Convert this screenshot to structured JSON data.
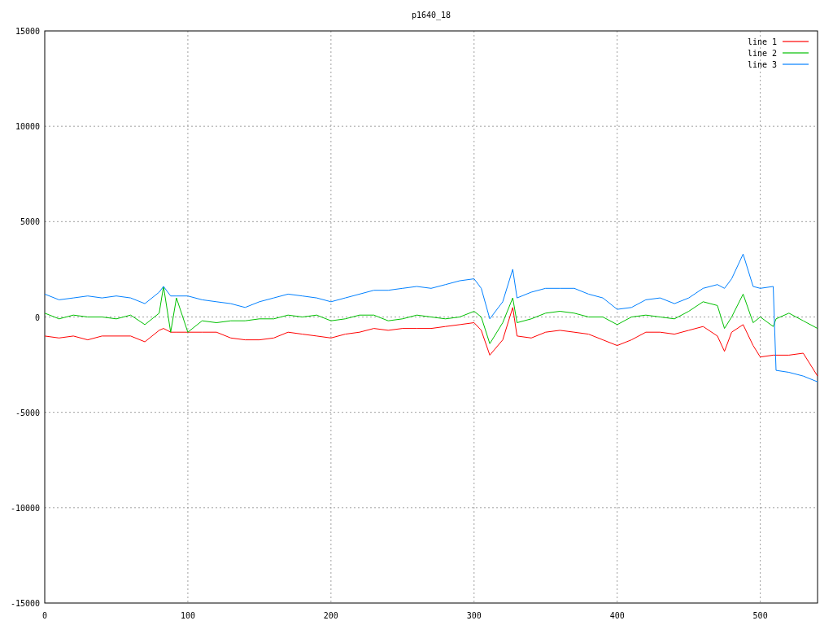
{
  "chart_data": {
    "type": "line",
    "title": "p1640_18",
    "x": [
      0,
      10,
      20,
      30,
      40,
      50,
      60,
      70,
      80,
      83,
      88,
      92,
      100,
      110,
      120,
      130,
      140,
      150,
      160,
      170,
      180,
      190,
      200,
      210,
      220,
      230,
      240,
      250,
      260,
      270,
      280,
      290,
      300,
      305,
      311,
      320,
      327,
      330,
      340,
      350,
      360,
      370,
      380,
      390,
      400,
      410,
      420,
      430,
      440,
      450,
      460,
      470,
      475,
      480,
      488,
      495,
      500,
      509,
      511,
      520,
      530,
      540
    ],
    "series": [
      {
        "name": "line 1",
        "color": "#ff0000",
        "values": [
          -1000,
          -1100,
          -1000,
          -1200,
          -1000,
          -1000,
          -1000,
          -1300,
          -700,
          -600,
          -800,
          -800,
          -800,
          -800,
          -800,
          -1100,
          -1200,
          -1200,
          -1100,
          -800,
          -900,
          -1000,
          -1100,
          -900,
          -800,
          -600,
          -700,
          -600,
          -600,
          -600,
          -500,
          -400,
          -300,
          -700,
          -2000,
          -1200,
          500,
          -1000,
          -1100,
          -800,
          -700,
          -800,
          -900,
          -1200,
          -1500,
          -1200,
          -800,
          -800,
          -900,
          -700,
          -500,
          -1000,
          -1800,
          -800,
          -400,
          -1500,
          -2100,
          -2000,
          -2000,
          -2000,
          -1900,
          -3100
        ]
      },
      {
        "name": "line 2",
        "color": "#00c000",
        "values": [
          200,
          -100,
          100,
          0,
          0,
          -100,
          100,
          -400,
          200,
          1600,
          -800,
          1000,
          -800,
          -200,
          -300,
          -200,
          -200,
          -100,
          -100,
          100,
          0,
          100,
          -200,
          -100,
          100,
          100,
          -200,
          -100,
          100,
          0,
          -100,
          0,
          300,
          0,
          -1400,
          -300,
          1000,
          -300,
          -100,
          200,
          300,
          200,
          0,
          0,
          -400,
          0,
          100,
          0,
          -100,
          300,
          800,
          600,
          -600,
          0,
          1200,
          -300,
          0,
          -500,
          -100,
          200,
          -200,
          -600
        ]
      },
      {
        "name": "line 3",
        "color": "#0080ff",
        "values": [
          1200,
          900,
          1000,
          1100,
          1000,
          1100,
          1000,
          700,
          1300,
          1600,
          1100,
          1100,
          1100,
          900,
          800,
          700,
          500,
          800,
          1000,
          1200,
          1100,
          1000,
          800,
          1000,
          1200,
          1400,
          1400,
          1500,
          1600,
          1500,
          1700,
          1900,
          2000,
          1500,
          -100,
          800,
          2500,
          1000,
          1300,
          1500,
          1500,
          1500,
          1200,
          1000,
          400,
          500,
          900,
          1000,
          700,
          1000,
          1500,
          1700,
          1500,
          2000,
          3300,
          1600,
          1500,
          1600,
          -2800,
          -2900,
          -3100,
          -3400
        ]
      }
    ],
    "grid": true,
    "legend": true,
    "xlim": [
      0,
      540
    ],
    "ylim": [
      -15000,
      15000
    ],
    "xticks": [
      0,
      100,
      200,
      300,
      400,
      500
    ],
    "yticks": [
      -15000,
      -10000,
      -5000,
      0,
      5000,
      10000,
      15000
    ]
  }
}
